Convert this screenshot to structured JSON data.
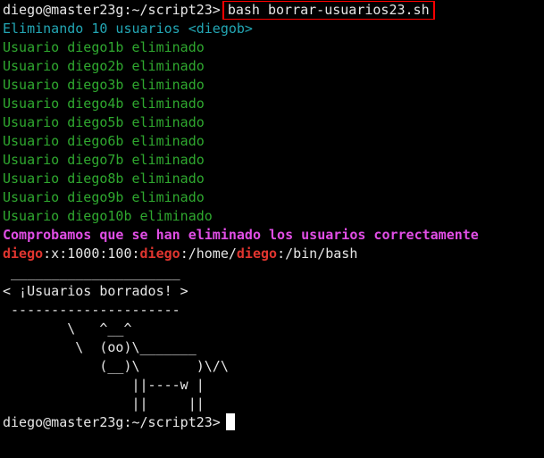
{
  "prompt1": "diego@master23g:~/script23>",
  "command1": "bash borrar-usuarios23.sh",
  "header_line": "Eliminando 10 usuarios <diegob>",
  "deleted_lines": [
    "Usuario diego1b eliminado",
    "Usuario diego2b eliminado",
    "Usuario diego3b eliminado",
    "Usuario diego4b eliminado",
    "Usuario diego5b eliminado",
    "Usuario diego6b eliminado",
    "Usuario diego7b eliminado",
    "Usuario diego8b eliminado",
    "Usuario diego9b eliminado",
    "Usuario diego10b eliminado"
  ],
  "check_line": "Comprobamos que se han eliminado los usuarios correctamente",
  "passwd_line": {
    "p1": "diego",
    "p2": ":x:1000:100:",
    "p3": "diego",
    "p4": ":/home/",
    "p5": "diego",
    "p6": ":/bin/bash"
  },
  "cowsay": [
    " _____________________",
    "< ¡Usuarios borrados! >",
    " ---------------------",
    "        \\   ^__^",
    "         \\  (oo)\\_______",
    "            (__)\\       )\\/\\",
    "                ||----w |",
    "                ||     ||"
  ],
  "prompt2": "diego@master23g:~/script23>",
  "colors": {
    "background": "#000000",
    "cyan": "#23a6b4",
    "green": "#2fa82f",
    "magenta": "#e14ee6",
    "red": "#e0352f",
    "highlight_border": "#ff0000"
  }
}
